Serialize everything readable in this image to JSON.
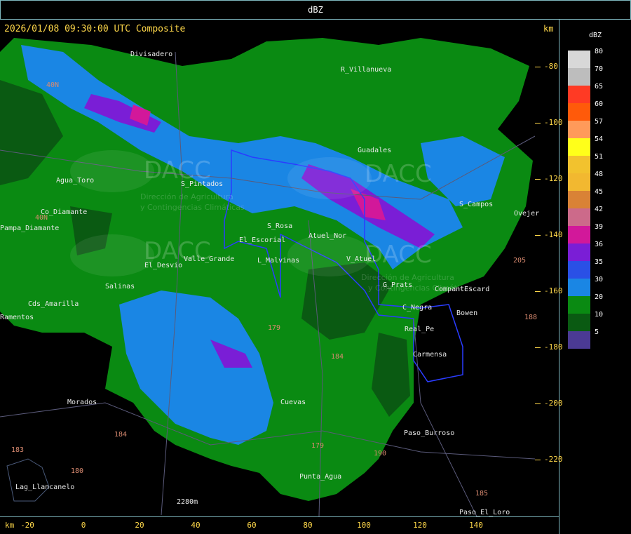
{
  "header": {
    "title": "dBZ"
  },
  "map_info": {
    "timestamp": "2026/01/08 09:30:00 UTC Composite",
    "unit_top": "km",
    "unit_bottom": "km"
  },
  "legend": {
    "title": "dBZ",
    "items": [
      {
        "label": "80",
        "color": "#d8d8d8"
      },
      {
        "label": "70",
        "color": "#bdbdbd"
      },
      {
        "label": "65",
        "color": "#ff3a24"
      },
      {
        "label": "60",
        "color": "#ff5a0a"
      },
      {
        "label": "57",
        "color": "#ff9a5a"
      },
      {
        "label": "54",
        "color": "#ffff1a"
      },
      {
        "label": "51",
        "color": "#f2c22e"
      },
      {
        "label": "48",
        "color": "#f2b830"
      },
      {
        "label": "45",
        "color": "#d98236"
      },
      {
        "label": "42",
        "color": "#cc6a8a"
      },
      {
        "label": "39",
        "color": "#d2189a"
      },
      {
        "label": "36",
        "color": "#7a1ed6"
      },
      {
        "label": "35",
        "color": "#2a50e6"
      },
      {
        "label": "30",
        "color": "#1a86e4"
      },
      {
        "label": "20",
        "color": "#0a8a12"
      },
      {
        "label": "10",
        "color": "#0a5a12"
      },
      {
        "label": "5",
        "color": "#4b3a94"
      }
    ]
  },
  "axes": {
    "x_ticks": [
      "-20",
      "0",
      "20",
      "40",
      "60",
      "80",
      "100",
      "120",
      "140"
    ],
    "y_ticks": [
      "-80",
      "-100",
      "-120",
      "-140",
      "-160",
      "-180",
      "-200",
      "-220"
    ]
  },
  "places": [
    {
      "name": "Divisadero"
    },
    {
      "name": "R_Villanueva"
    },
    {
      "name": "Guadales"
    },
    {
      "name": "Agua_Toro"
    },
    {
      "name": "Co_Diamante"
    },
    {
      "name": "Pampa_Diamante"
    },
    {
      "name": "S_Pintados"
    },
    {
      "name": "S_Rosa"
    },
    {
      "name": "El_Escorial"
    },
    {
      "name": "Atuel_Nor"
    },
    {
      "name": "Valle_Grande"
    },
    {
      "name": "El_Desvio"
    },
    {
      "name": "L_Malvinas"
    },
    {
      "name": "V_Atuel"
    },
    {
      "name": "Salinas"
    },
    {
      "name": "Cds_Amarilla"
    },
    {
      "name": "G_Prats"
    },
    {
      "name": "C_Negra"
    },
    {
      "name": "Bowen"
    },
    {
      "name": "CompantEscard"
    },
    {
      "name": "Real_Pe"
    },
    {
      "name": "Carmensa"
    },
    {
      "name": "Morados"
    },
    {
      "name": "Paso_Burroso"
    },
    {
      "name": "Lag_Llancanelo"
    },
    {
      "name": "Punta_Agua"
    },
    {
      "name": "Paso_El_Loro"
    },
    {
      "name": "2280m"
    },
    {
      "name": "S_Campos"
    },
    {
      "name": "Ovejer"
    },
    {
      "name": "Ramentos"
    },
    {
      "name": "Cuevas"
    }
  ],
  "routes": [
    "40N",
    "40N",
    "179",
    "184",
    "184",
    "183",
    "180",
    "179",
    "190",
    "205",
    "185",
    "188"
  ],
  "watermark": {
    "brand": "DACC",
    "line1": "Dirección de Agricultura",
    "line2": "y Contingencias Climáticas"
  }
}
